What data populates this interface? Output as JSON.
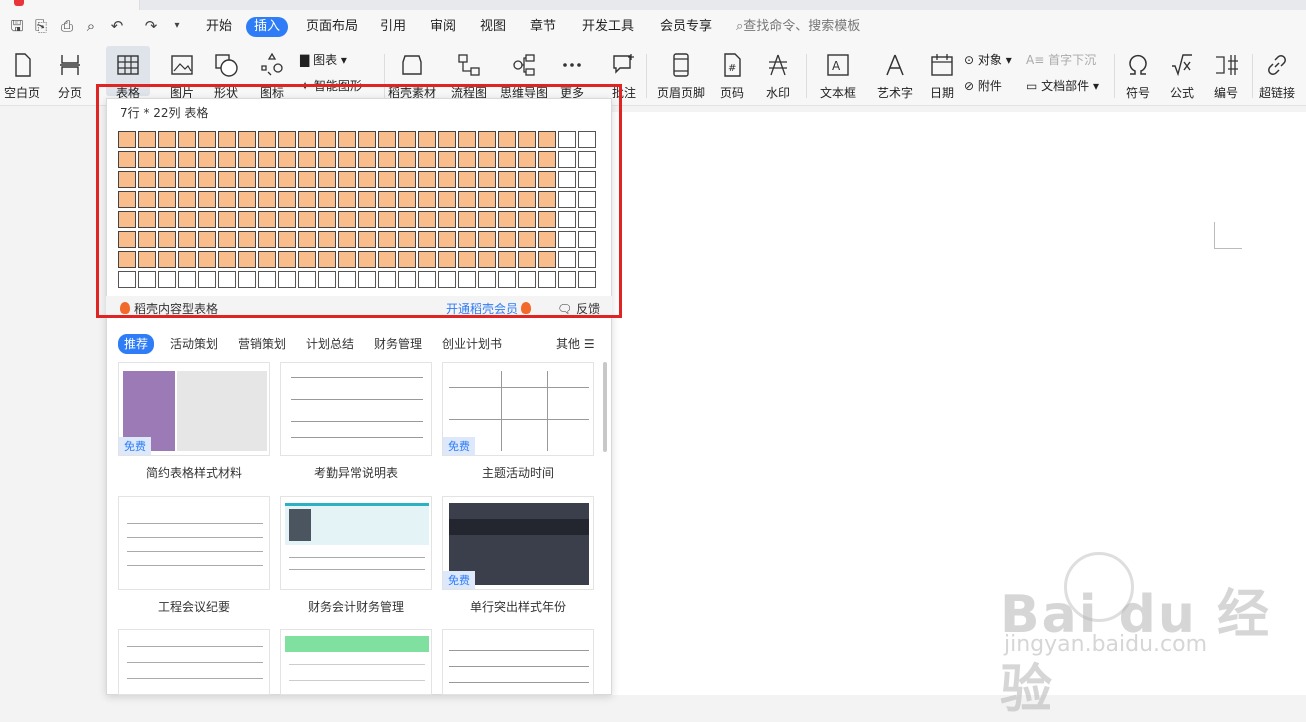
{
  "menu": {
    "items": [
      "开始",
      "插入",
      "页面布局",
      "引用",
      "审阅",
      "视图",
      "章节",
      "开发工具",
      "会员专享"
    ],
    "active": "插入",
    "search_placeholder": "查找命令、搜索模板"
  },
  "ribbon": {
    "blank_page": "空白页",
    "page_break": "分页",
    "table": "表格",
    "picture": "图片",
    "shape": "形状",
    "icon": "图标",
    "chart": "图表",
    "smart_art": "智能图形",
    "daoke_material": "稻壳素材",
    "flowchart": "流程图",
    "mindmap": "思维导图",
    "more": "更多",
    "comment": "批注",
    "header_footer": "页眉页脚",
    "page_number": "页码",
    "watermark": "水印",
    "textbox": "文本框",
    "wordart": "艺术字",
    "date": "日期",
    "object": "对象",
    "attachment": "附件",
    "dropcap": "首字下沉",
    "doc_parts": "文档部件",
    "symbol": "符号",
    "formula": "公式",
    "numbering": "编号",
    "hyperlink": "超链接"
  },
  "table_grid": {
    "header": "7行 * 22列 表格",
    "rows": 8,
    "cols": 24,
    "selected_rows": 7,
    "selected_cols": 22,
    "highlight_color": "#f9bd8c",
    "footer_left": "稻壳内容型表格",
    "footer_mid": "开通稻壳会员",
    "footer_right": "反馈"
  },
  "categories": [
    "推荐",
    "活动策划",
    "营销策划",
    "计划总结",
    "财务管理",
    "创业计划书"
  ],
  "categories_active": "推荐",
  "categories_more": "其他",
  "templates": [
    {
      "title": "简约表格样式材料",
      "free": "免费"
    },
    {
      "title": "考勤异常说明表",
      "free": ""
    },
    {
      "title": "主题活动时间",
      "free": "免费"
    },
    {
      "title": "工程会议纪要",
      "free": ""
    },
    {
      "title": "财务会计财务管理",
      "free": ""
    },
    {
      "title": "单行突出样式年份",
      "free": "免费"
    }
  ],
  "watermark": {
    "main": "Bai du 经验",
    "sub": "jingyan.baidu.com"
  }
}
